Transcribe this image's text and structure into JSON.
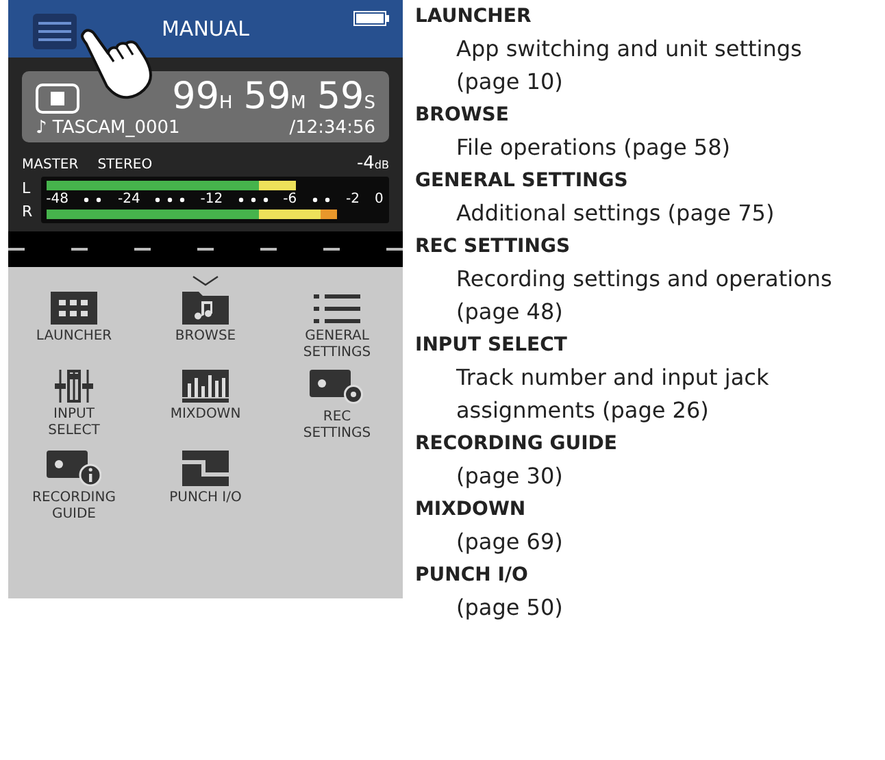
{
  "device": {
    "header": {
      "title": "MANUAL"
    },
    "transport": {
      "hours": "99",
      "hours_unit": "H",
      "minutes": "59",
      "minutes_unit": "M",
      "seconds": "59",
      "seconds_unit": "S",
      "file": "♪ TASCAM_0001",
      "total": "/12:34:56"
    },
    "meter": {
      "source": "MASTER",
      "mode": "STEREO",
      "peak": "-4",
      "peak_unit": "dB",
      "channels": [
        {
          "name": "L",
          "level": 0.74
        },
        {
          "name": "R",
          "level": 0.86
        }
      ],
      "scale": [
        "-48",
        "-24",
        "-12",
        "-6",
        "-2",
        "0"
      ]
    },
    "menu": [
      {
        "kind": "launcher",
        "label": "LAUNCHER"
      },
      {
        "kind": "browse",
        "label": "BROWSE"
      },
      {
        "kind": "general",
        "label": "GENERAL SETTINGS"
      },
      {
        "kind": "input",
        "label": "INPUT SELECT"
      },
      {
        "kind": "mixdown",
        "label": "MIXDOWN"
      },
      {
        "kind": "rec",
        "label": "REC SETTINGS"
      },
      {
        "kind": "guide",
        "label": "RECORDING GUIDE"
      },
      {
        "kind": "punch",
        "label": "PUNCH I/O"
      }
    ]
  },
  "descriptions": [
    {
      "title": "LAUNCHER",
      "text": "App switching and unit settings (page 10)"
    },
    {
      "title": "BROWSE",
      "text": "File operations (page 58)"
    },
    {
      "title": "GENERAL SETTINGS",
      "text": "Additional settings (page 75)"
    },
    {
      "title": "REC SETTINGS",
      "text": "Recording settings and operations (page 48)"
    },
    {
      "title": "INPUT SELECT",
      "text": "Track number and input jack assignments (page 26)"
    },
    {
      "title": "RECORDING GUIDE",
      "text": "(page 30)"
    },
    {
      "title": "MIXDOWN",
      "text": "(page 69)"
    },
    {
      "title": "PUNCH I/O",
      "text": "(page 50)"
    }
  ]
}
